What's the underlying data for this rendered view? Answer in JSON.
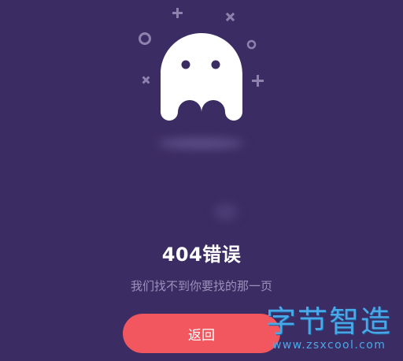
{
  "error": {
    "title": "404错误",
    "message": "我们找不到你要找的那一页",
    "button_label": "返回"
  },
  "illustration": {
    "icon": "ghost-icon",
    "decorations": [
      "plus-icon",
      "close-icon",
      "circle-icon",
      "circle-icon",
      "close-icon",
      "plus-icon"
    ]
  },
  "watermark": {
    "title": "字节智造",
    "url": "www.zsxcool.com"
  },
  "colors": {
    "background": "#3b2c63",
    "accent": "#f2565f",
    "decoration": "#8d82ad",
    "subtitle": "#9b91bb",
    "watermark": "#4aa8e8"
  }
}
